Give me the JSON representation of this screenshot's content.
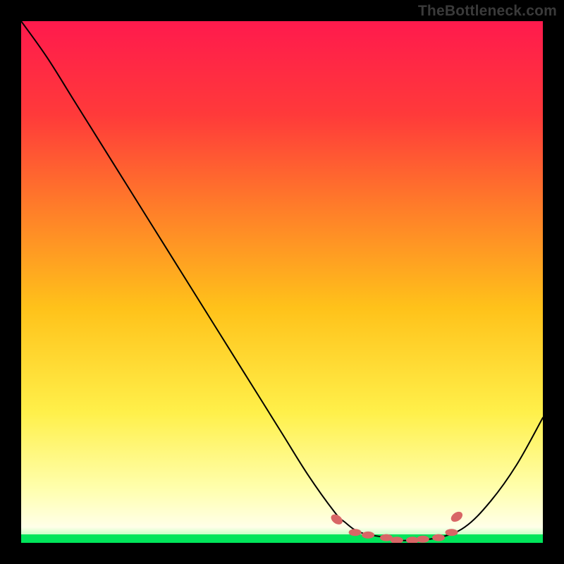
{
  "attribution": "TheBottleneck.com",
  "colors": {
    "gradient_top": "#ff1a4d",
    "gradient_mid_upper": "#ff6a2a",
    "gradient_mid": "#ffd21a",
    "gradient_lower": "#fff56a",
    "gradient_near_bottom": "#ffffe0",
    "bottom_band": "#00e55a",
    "curve": "#000000",
    "markers": "#d86666",
    "background": "#000000"
  },
  "chart_data": {
    "type": "line",
    "title": "",
    "xlabel": "",
    "ylabel": "",
    "x": [
      0.0,
      0.05,
      0.1,
      0.15,
      0.2,
      0.25,
      0.3,
      0.35,
      0.4,
      0.45,
      0.5,
      0.55,
      0.6,
      0.62,
      0.65,
      0.7,
      0.72,
      0.75,
      0.8,
      0.85,
      0.9,
      0.95,
      1.0
    ],
    "values": [
      1.0,
      0.93,
      0.85,
      0.77,
      0.69,
      0.61,
      0.53,
      0.45,
      0.37,
      0.29,
      0.21,
      0.13,
      0.06,
      0.04,
      0.02,
      0.01,
      0.005,
      0.005,
      0.01,
      0.03,
      0.08,
      0.15,
      0.24
    ],
    "xlim": [
      0,
      1
    ],
    "ylim": [
      0,
      1
    ],
    "markers": [
      {
        "x": 0.605,
        "y": 0.045
      },
      {
        "x": 0.64,
        "y": 0.02
      },
      {
        "x": 0.665,
        "y": 0.015
      },
      {
        "x": 0.7,
        "y": 0.01
      },
      {
        "x": 0.72,
        "y": 0.005
      },
      {
        "x": 0.75,
        "y": 0.005
      },
      {
        "x": 0.77,
        "y": 0.007
      },
      {
        "x": 0.8,
        "y": 0.01
      },
      {
        "x": 0.825,
        "y": 0.02
      },
      {
        "x": 0.835,
        "y": 0.05
      }
    ]
  }
}
